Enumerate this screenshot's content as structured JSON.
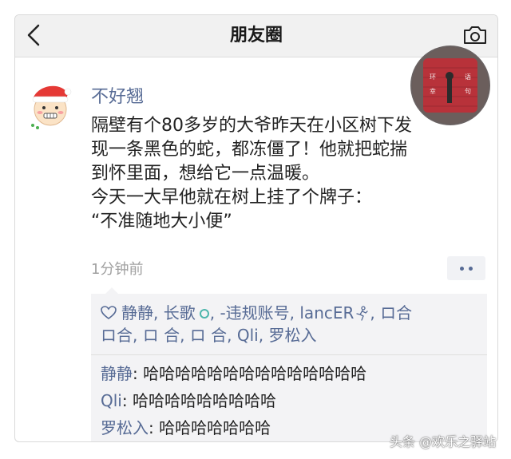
{
  "navbar": {
    "title": "朋友圈"
  },
  "post": {
    "username": "不好翘",
    "text_lines": [
      "隔壁有个80多岁的大爷昨天在小区树下发",
      "现一条黑色的蛇，都冻僵了！他就把蛇揣",
      "到怀里面，想给它一点温暖。",
      "今天一大早他就在树上挂了个牌子：",
      "“不准随地大小便”"
    ],
    "timestamp": "1分钟前"
  },
  "thumb_chars": {
    "left_top": "环",
    "left_bottom": "幸",
    "right_top": "语",
    "right_bottom": "句"
  },
  "likes": {
    "names": [
      "静静",
      "长歌",
      "-违规账号",
      "lancER",
      "ロ合",
      "ロ合",
      "ロ 合",
      "ロ 合",
      "Qli",
      "罗松入"
    ],
    "sep": ", "
  },
  "comments": [
    {
      "name": "静静",
      "colon": ": ",
      "text": "哈哈哈哈哈哈哈哈哈哈哈哈哈哈"
    },
    {
      "name": "Qli",
      "colon": ": ",
      "text": "哈哈哈哈哈哈哈哈哈"
    },
    {
      "name": "罗松入",
      "colon": ": ",
      "text": "哈哈哈哈哈哈哈"
    }
  ],
  "watermark": "头条 @欢乐之驿站",
  "colors": {
    "link": "#576b95",
    "navbar_bg": "#f1f1f1",
    "panel_bg": "#f3f3f5"
  }
}
